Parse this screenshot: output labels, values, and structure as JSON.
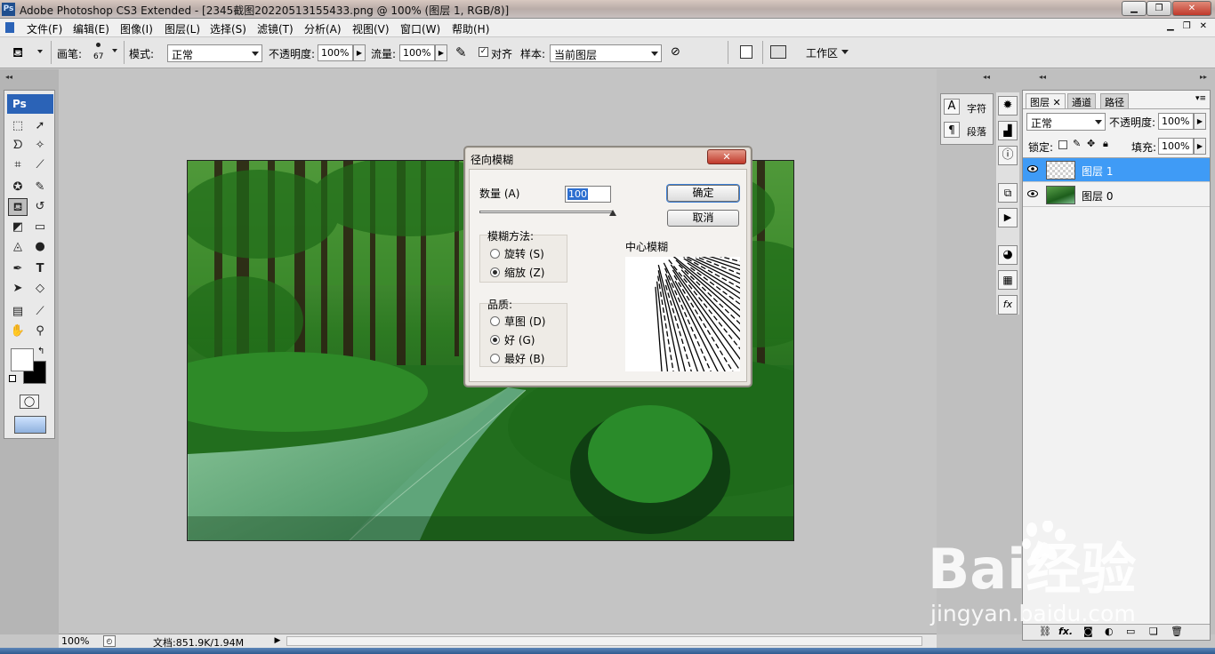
{
  "titlebar": {
    "app_icon": "Ps",
    "title": "Adobe Photoshop CS3 Extended - [2345截图20220513155433.png @ 100% (图层 1, RGB/8)]"
  },
  "menubar": {
    "items": [
      "文件(F)",
      "编辑(E)",
      "图像(I)",
      "图层(L)",
      "选择(S)",
      "滤镜(T)",
      "分析(A)",
      "视图(V)",
      "窗口(W)",
      "帮助(H)"
    ]
  },
  "options": {
    "brush_label": "画笔:",
    "brush_size": "67",
    "mode_label": "模式:",
    "mode_value": "正常",
    "opacity_label": "不透明度:",
    "opacity_value": "100%",
    "flow_label": "流量:",
    "flow_value": "100%",
    "aligned_label": "对齐",
    "sample_label": "样本:",
    "sample_value": "当前图层",
    "workspace_label": "工作区"
  },
  "toolbox": {
    "logo": "Ps"
  },
  "dialog": {
    "title": "径向模糊",
    "amount_label": "数量 (A)",
    "amount_value": "100",
    "ok_label": "确定",
    "cancel_label": "取消",
    "method_label": "模糊方法:",
    "method_spin": "旋转 (S)",
    "method_zoom": "缩放 (Z)",
    "method_selected": "缩放",
    "quality_label": "品质:",
    "quality_draft": "草图 (D)",
    "quality_good": "好 (G)",
    "quality_best": "最好 (B)",
    "quality_selected": "好",
    "center_label": "中心模糊"
  },
  "mini_panel": {
    "character": "字符",
    "paragraph": "段落"
  },
  "layers_panel": {
    "tabs": [
      "图层",
      "通道",
      "路径"
    ],
    "blend_mode": "正常",
    "opacity_label": "不透明度:",
    "opacity_value": "100%",
    "lock_label": "锁定:",
    "fill_label": "填充:",
    "fill_value": "100%",
    "layers": [
      {
        "name": "图层 1",
        "selected": true
      },
      {
        "name": "图层 0",
        "selected": false
      }
    ],
    "fx_label": "fx."
  },
  "status": {
    "zoom": "100%",
    "doc_info": "文档:851.9K/1.94M"
  },
  "watermark": {
    "brand": "Bai经验",
    "url": "jingyan.baidu.com"
  },
  "colors": {
    "selected_layer": "#3f9bf6",
    "ps_blue": "#2b63b7",
    "foliage": "#2f7d24"
  }
}
